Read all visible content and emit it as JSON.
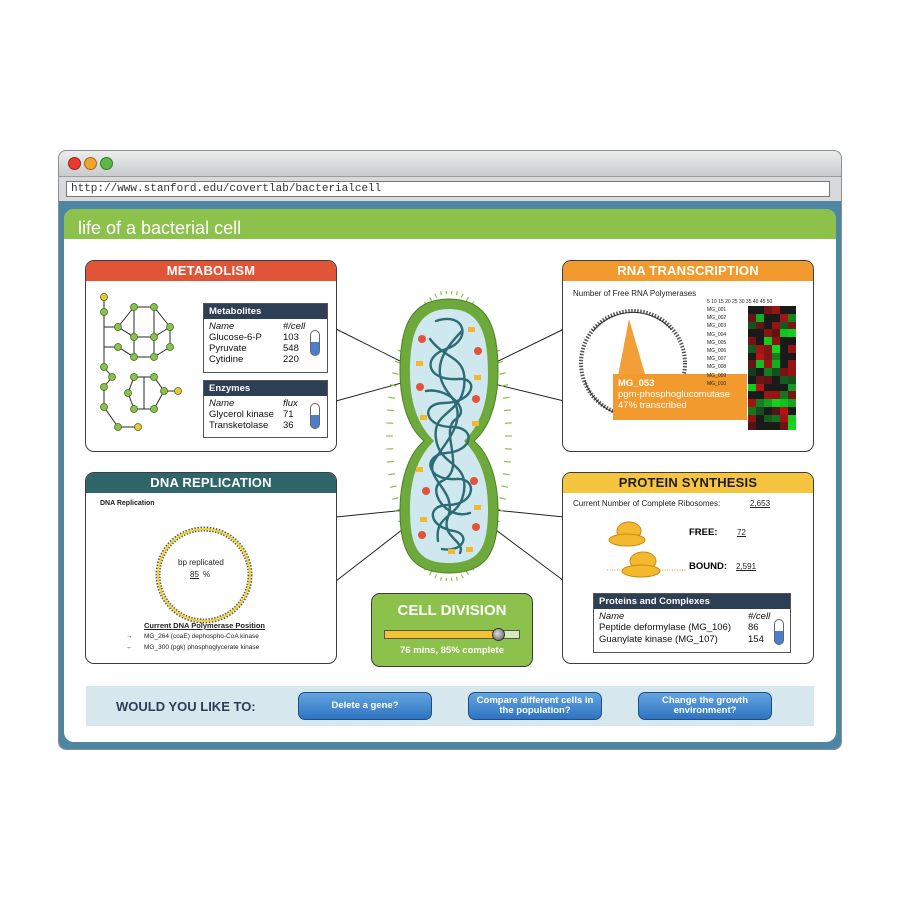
{
  "browser": {
    "url": "http://www.stanford.edu/covertlab/bacterialcell"
  },
  "page": {
    "title": "life of a bacterial cell"
  },
  "metabolism": {
    "title": "METABOLISM",
    "metabolites": {
      "title": "Metabolites",
      "col_name": "Name",
      "col_value": "#/cell",
      "rows": [
        {
          "name": "Glucose-6-P",
          "value": "103"
        },
        {
          "name": "Pyruvate",
          "value": "548"
        },
        {
          "name": "Cytidine",
          "value": "220"
        }
      ]
    },
    "enzymes": {
      "title": "Enzymes",
      "col_name": "Name",
      "col_value": "flux",
      "rows": [
        {
          "name": "Glycerol kinase",
          "value": "71"
        },
        {
          "name": "Transketolase",
          "value": "36"
        }
      ]
    }
  },
  "rna": {
    "title": "RNA TRANSCRIPTION",
    "subtitle": "Number of Free RNA Polymerases",
    "heatmap_header": "5 10 15 20 25 30 35 40 45 50",
    "genes": [
      "MG_001",
      "MG_002",
      "MG_003",
      "MG_004",
      "MG_005",
      "MG_006",
      "MG_007",
      "MG_008",
      "MG_009",
      "MG_010"
    ],
    "callout": {
      "gene": "MG_053",
      "name": "pgm-phosphoglucomutase",
      "status": "47% transcribed"
    }
  },
  "dna": {
    "title": "DNA REPLICATION",
    "subtitle": "DNA Replication",
    "bp_label": "bp replicated",
    "bp_value": "85",
    "bp_unit": "%",
    "position_title": "Current DNA Polymerase Position",
    "positions": [
      {
        "arrow": "→",
        "text": "MG_264 (coaE) dephospho-CoA kinase"
      },
      {
        "arrow": "←",
        "text": "MG_300 (pgk) phosphoglycerate kinase"
      }
    ]
  },
  "protein": {
    "title": "PROTEIN SYNTHESIS",
    "ribosome_label": "Current Number of Complete Ribosomes:",
    "ribosome_count": "2,653",
    "free_label": "FREE:",
    "free_value": "72",
    "bound_label": "BOUND:",
    "bound_value": "2,591",
    "complexes": {
      "title": "Proteins and Complexes",
      "col_name": "Name",
      "col_value": "#/cell",
      "rows": [
        {
          "name": "Peptide deformylase (MG_106)",
          "value": "86"
        },
        {
          "name": "Guanylate kinase (MG_107)",
          "value": "154"
        }
      ]
    }
  },
  "division": {
    "title": "CELL DIVISION",
    "status": "76 mins, 85% complete",
    "progress": 0.85
  },
  "actions": {
    "prompt": "WOULD YOU LIKE TO:",
    "buttons": [
      {
        "label": "Delete a gene?"
      },
      {
        "label": "Compare different cells in the population?"
      },
      {
        "label": "Change the growth environment?"
      }
    ]
  },
  "colors": {
    "metabolism": "#e05438",
    "rna": "#f29a2e",
    "dna": "#2f6669",
    "protein": "#f5c540",
    "green": "#8cc14c",
    "frame_blue": "#4d86a3",
    "button_blue": "#3f86cf"
  }
}
